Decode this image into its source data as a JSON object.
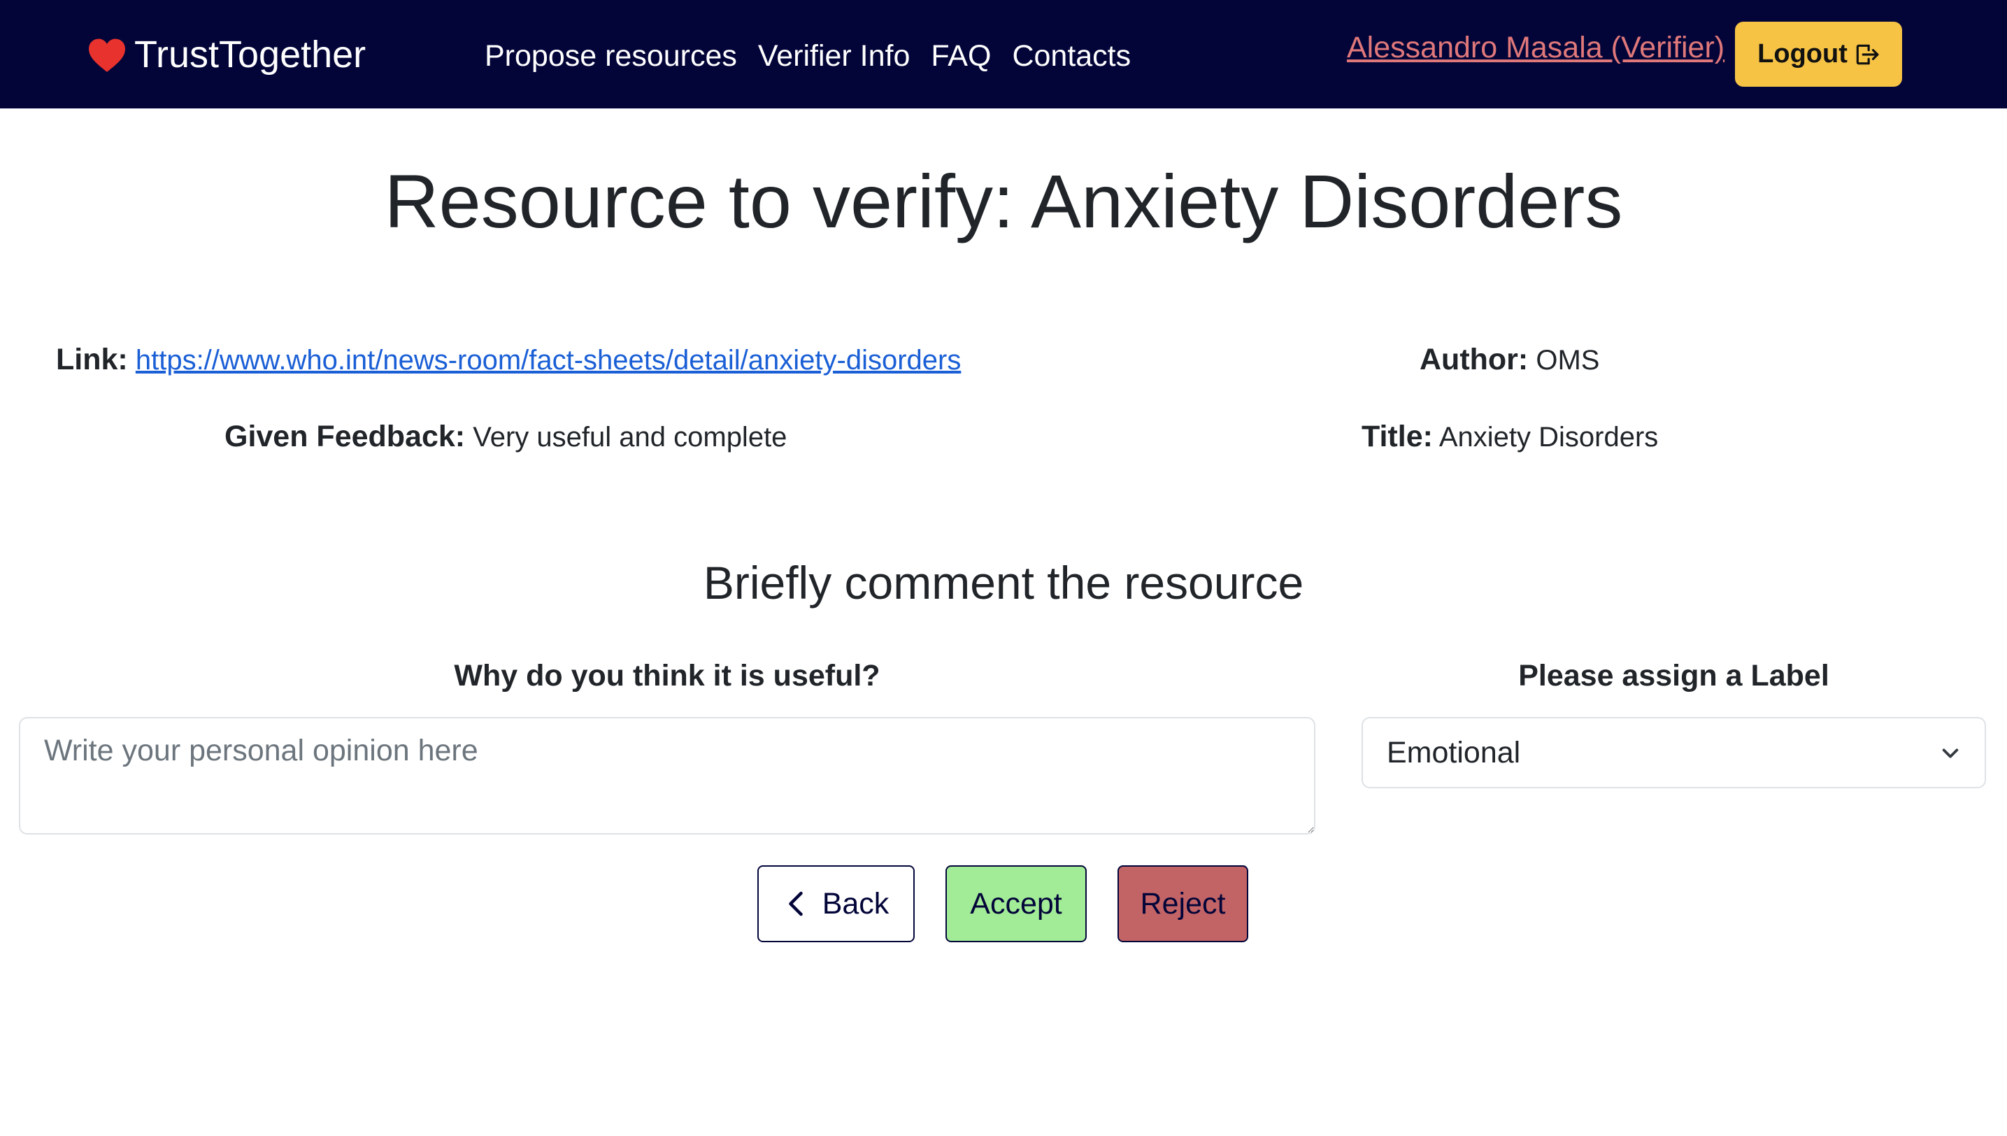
{
  "app": {
    "brand": "TrustTogether",
    "brand_icon": "heart-icon",
    "brand_color": "#e8322d"
  },
  "nav": {
    "links": [
      "Propose resources",
      "Verifier Info",
      "FAQ",
      "Contacts"
    ],
    "user": "Alessandro Masala (Verifier)",
    "logout_label": "Logout",
    "logout_icon": "logout-icon",
    "background": "#030539",
    "logout_color": "#f6c345"
  },
  "page": {
    "title": "Resource to verify: Anxiety Disorders"
  },
  "resource": {
    "link_label": "Link:",
    "link_url": "https://www.who.int/news-room/fact-sheets/detail/anxiety-disorders",
    "author_label": "Author:",
    "author": "OMS",
    "feedback_label": "Given Feedback:",
    "feedback": "Very useful and complete",
    "title_label": "Title:",
    "title": "Anxiety Disorders"
  },
  "comment": {
    "heading": "Briefly comment the resource",
    "opinion_label": "Why do you think it is useful?",
    "opinion_placeholder": "Write your personal opinion here",
    "opinion_value": "",
    "label_heading": "Please assign a Label",
    "label_selected": "Emotional"
  },
  "actions": {
    "back": "Back",
    "accept": "Accept",
    "reject": "Reject",
    "accept_color": "#a2eb97",
    "reject_color": "#c26466"
  }
}
